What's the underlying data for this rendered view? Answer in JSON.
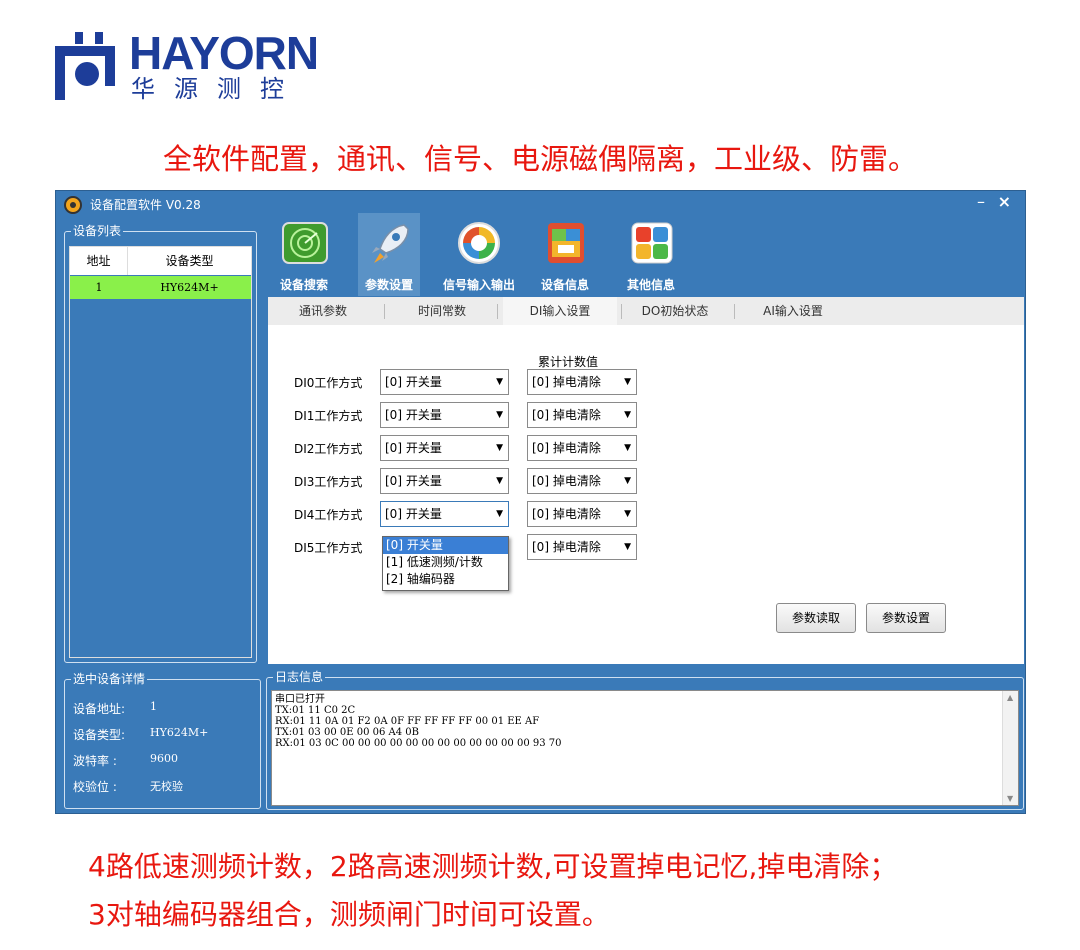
{
  "logo": {
    "en": "HAYORN",
    "cn": "华源测控"
  },
  "headline": "全软件配置，通讯、信号、电源磁偶隔离，工业级、防雷。",
  "footer": {
    "line1": "4路低速测频计数，2路高速测频计数,可设置掉电记忆,掉电清除；",
    "line2": "3对轴编码器组合，测频闸门时间可设置。"
  },
  "window": {
    "title": "设备配置软件 V0.28",
    "minimize": "–",
    "close": "×"
  },
  "device_list": {
    "group_label": "设备列表",
    "columns": [
      "地址",
      "设备类型"
    ],
    "rows": [
      {
        "addr": "1",
        "type": "HY624M+"
      }
    ]
  },
  "device_detail": {
    "group_label": "选中设备详情",
    "rows": [
      {
        "label": "设备地址:",
        "value": "1"
      },
      {
        "label": "设备类型:",
        "value": "HY624M+"
      },
      {
        "label": "波特率 :",
        "value": "9600"
      },
      {
        "label": "校验位 :",
        "value": "无校验"
      }
    ]
  },
  "toolbar": {
    "buttons": [
      {
        "label": "设备搜索",
        "icon": "radar-icon"
      },
      {
        "label": "参数设置",
        "icon": "rocket-icon"
      },
      {
        "label": "信号输入输出",
        "icon": "sync-icon"
      },
      {
        "label": "设备信息",
        "icon": "info-icon"
      },
      {
        "label": "其他信息",
        "icon": "tiles-icon"
      }
    ],
    "active": "参数设置"
  },
  "tabs": [
    "通讯参数",
    "时间常数",
    "DI输入设置",
    "DO初始状态",
    "AI输入设置"
  ],
  "active_tab": "DI输入设置",
  "di_settings": {
    "accum_header": "累计计数值",
    "rows": [
      {
        "label": "DI0工作方式",
        "mode": "[0] 开关量",
        "accum": "[0] 掉电清除"
      },
      {
        "label": "DI1工作方式",
        "mode": "[0] 开关量",
        "accum": "[0] 掉电清除"
      },
      {
        "label": "DI2工作方式",
        "mode": "[0] 开关量",
        "accum": "[0] 掉电清除"
      },
      {
        "label": "DI3工作方式",
        "mode": "[0] 开关量",
        "accum": "[0] 掉电清除"
      },
      {
        "label": "DI4工作方式",
        "mode": "[0] 开关量",
        "accum": "[0] 掉电清除"
      },
      {
        "label": "DI5工作方式",
        "mode": "[0] 开关量",
        "accum": "[0] 掉电清除"
      }
    ],
    "dropdown_options": [
      "[0] 开关量",
      "[1] 低速测频/计数",
      "[2] 轴编码器"
    ],
    "dropdown_selected": "[0] 开关量",
    "read_button": "参数读取",
    "set_button": "参数设置"
  },
  "log": {
    "group_label": "日志信息",
    "lines": [
      "串口已打开",
      "TX:01 11 C0 2C",
      "RX:01 11 0A 01 F2 0A 0F FF FF FF FF 00 01 EE AF",
      "TX:01 03 00 0E 00 06 A4 0B",
      "RX:01 03 0C 00 00 00 00 00 00 00 00 00 00 00 00 93 70"
    ]
  }
}
